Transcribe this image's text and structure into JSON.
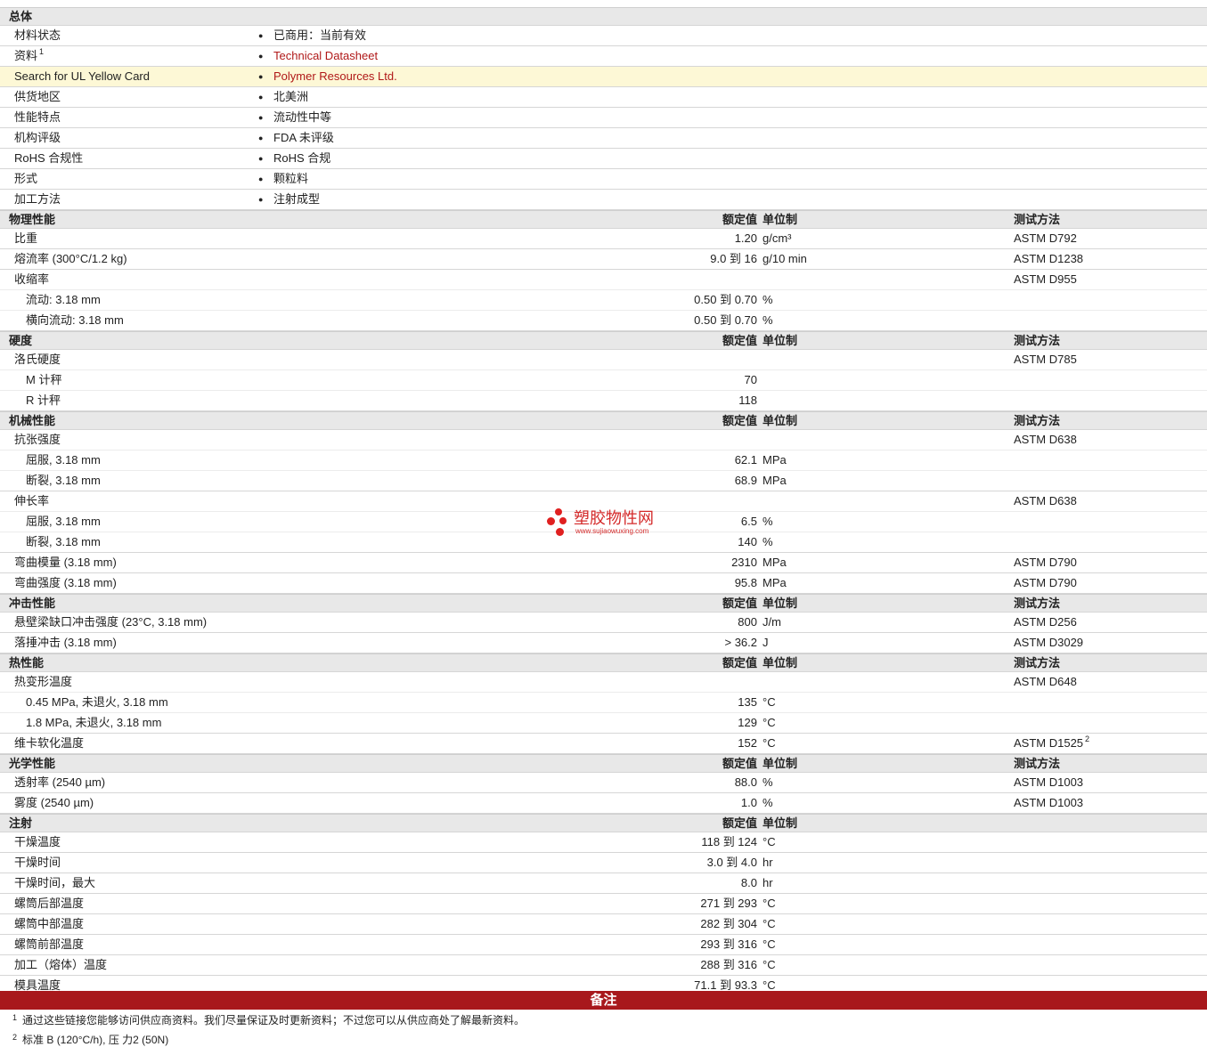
{
  "general": {
    "title": "总体",
    "rows": [
      {
        "label": "材料状态",
        "value": "已商用：当前有效"
      },
      {
        "label": "资料",
        "sup": "1",
        "value": "Technical Datasheet",
        "link": true
      },
      {
        "label": "Search for UL Yellow Card",
        "value": "Polymer Resources Ltd.",
        "link": true,
        "highlight": true
      },
      {
        "label": "供货地区",
        "value": "北美洲"
      },
      {
        "label": "性能特点",
        "value": "流动性中等"
      },
      {
        "label": "机构评级",
        "value": "FDA 未评级"
      },
      {
        "label": "RoHS 合规性",
        "value": "RoHS 合规"
      },
      {
        "label": "形式",
        "value": "颗粒料"
      },
      {
        "label": "加工方法",
        "value": "注射成型"
      }
    ]
  },
  "sections": [
    {
      "title": "物理性能",
      "nominal_header": "额定值",
      "unit_header": "单位制",
      "method_header": "测试方法",
      "rows": [
        {
          "label": "比重",
          "nominal": "1.20",
          "unit": "g/cm³",
          "method": "ASTM D792"
        },
        {
          "label": "熔流率 (300°C/1.2 kg)",
          "nominal": "9.0 到 16",
          "unit": "g/10 min",
          "method": "ASTM D1238"
        },
        {
          "label": "收缩率",
          "nominal": "",
          "unit": "",
          "method": "ASTM D955"
        },
        {
          "label": "流动: 3.18 mm",
          "indent": true,
          "nominal": "0.50 到 0.70",
          "unit": "%",
          "method": ""
        },
        {
          "label": "横向流动: 3.18 mm",
          "indent": true,
          "nominal": "0.50 到 0.70",
          "unit": "%",
          "method": ""
        }
      ]
    },
    {
      "title": "硬度",
      "nominal_header": "额定值",
      "unit_header": "单位制",
      "method_header": "测试方法",
      "rows": [
        {
          "label": "洛氏硬度",
          "nominal": "",
          "unit": "",
          "method": "ASTM D785"
        },
        {
          "label": "M 计秤",
          "indent": true,
          "nominal": "70",
          "unit": "",
          "method": ""
        },
        {
          "label": "R 计秤",
          "indent": true,
          "nominal": "118",
          "unit": "",
          "method": ""
        }
      ]
    },
    {
      "title": "机械性能",
      "nominal_header": "额定值",
      "unit_header": "单位制",
      "method_header": "测试方法",
      "rows": [
        {
          "label": "抗张强度",
          "nominal": "",
          "unit": "",
          "method": "ASTM D638"
        },
        {
          "label": "屈服, 3.18 mm",
          "indent": true,
          "nominal": "62.1",
          "unit": "MPa",
          "method": ""
        },
        {
          "label": "断裂, 3.18 mm",
          "indent": true,
          "nominal": "68.9",
          "unit": "MPa",
          "method": ""
        },
        {
          "label": "伸长率",
          "nominal": "",
          "unit": "",
          "method": "ASTM D638"
        },
        {
          "label": "屈服, 3.18 mm",
          "indent": true,
          "nominal": "6.5",
          "unit": "%",
          "method": ""
        },
        {
          "label": "断裂, 3.18 mm",
          "indent": true,
          "nominal": "140",
          "unit": "%",
          "method": ""
        },
        {
          "label": "弯曲模量 (3.18 mm)",
          "nominal": "2310",
          "unit": "MPa",
          "method": "ASTM D790"
        },
        {
          "label": "弯曲强度 (3.18 mm)",
          "nominal": "95.8",
          "unit": "MPa",
          "method": "ASTM D790"
        }
      ]
    },
    {
      "title": "冲击性能",
      "nominal_header": "额定值",
      "unit_header": "单位制",
      "method_header": "测试方法",
      "rows": [
        {
          "label": "悬壁梁缺口冲击强度 (23°C, 3.18 mm)",
          "nominal": "800",
          "unit": "J/m",
          "method": "ASTM D256"
        },
        {
          "label": "落捶冲击 (3.18 mm)",
          "nominal": "> 36.2",
          "unit": "J",
          "method": "ASTM D3029"
        }
      ]
    },
    {
      "title": "热性能",
      "nominal_header": "额定值",
      "unit_header": "单位制",
      "method_header": "测试方法",
      "rows": [
        {
          "label": "热变形温度",
          "nominal": "",
          "unit": "",
          "method": "ASTM D648"
        },
        {
          "label": "0.45 MPa, 未退火, 3.18 mm",
          "indent": true,
          "nominal": "135",
          "unit": "°C",
          "method": ""
        },
        {
          "label": "1.8 MPa, 未退火, 3.18 mm",
          "indent": true,
          "nominal": "129",
          "unit": "°C",
          "method": ""
        },
        {
          "label": "维卡软化温度",
          "nominal": "152",
          "unit": "°C",
          "method": "ASTM D1525",
          "method_sup": "2"
        }
      ]
    },
    {
      "title": "光学性能",
      "nominal_header": "额定值",
      "unit_header": "单位制",
      "method_header": "测试方法",
      "rows": [
        {
          "label": "透射率 (2540 µm)",
          "nominal": "88.0",
          "unit": "%",
          "method": "ASTM D1003"
        },
        {
          "label": "雾度 (2540 µm)",
          "nominal": "1.0",
          "unit": "%",
          "method": "ASTM D1003"
        }
      ]
    },
    {
      "title": "注射",
      "nominal_header": "额定值",
      "unit_header": "单位制",
      "method_header": "",
      "rows": [
        {
          "label": "干燥温度",
          "nominal": "118 到 124",
          "unit": "°C",
          "method": ""
        },
        {
          "label": "干燥时间",
          "nominal": "3.0 到 4.0",
          "unit": "hr",
          "method": ""
        },
        {
          "label": "干燥时间，最大",
          "nominal": "8.0",
          "unit": "hr",
          "method": ""
        },
        {
          "label": "螺筒后部温度",
          "nominal": "271 到 293",
          "unit": "°C",
          "method": ""
        },
        {
          "label": "螺筒中部温度",
          "nominal": "282 到 304",
          "unit": "°C",
          "method": ""
        },
        {
          "label": "螺筒前部温度",
          "nominal": "293 到 316",
          "unit": "°C",
          "method": ""
        },
        {
          "label": "加工（熔体）温度",
          "nominal": "288 到 316",
          "unit": "°C",
          "method": ""
        },
        {
          "label": "模具温度",
          "nominal": "71.1 到 93.3",
          "unit": "°C",
          "method": ""
        }
      ]
    }
  ],
  "notes": {
    "title": "备注",
    "items": [
      {
        "num": "1",
        "text": "通过这些链接您能够访问供应商资料。我们尽量保证及时更新资料；不过您可以从供应商处了解最新资料。"
      },
      {
        "num": "2",
        "text": "标准 B (120°C/h), 压 力2 (50N)"
      }
    ]
  },
  "watermark": {
    "cn": "塑胶物性网",
    "url": "www.sujiaowuxing.com"
  },
  "colors": {
    "link": "#b01818",
    "notes_bar": "#a8181c",
    "section_bg": "#e8e8e8",
    "highlight_bg": "#fdf8d6"
  }
}
